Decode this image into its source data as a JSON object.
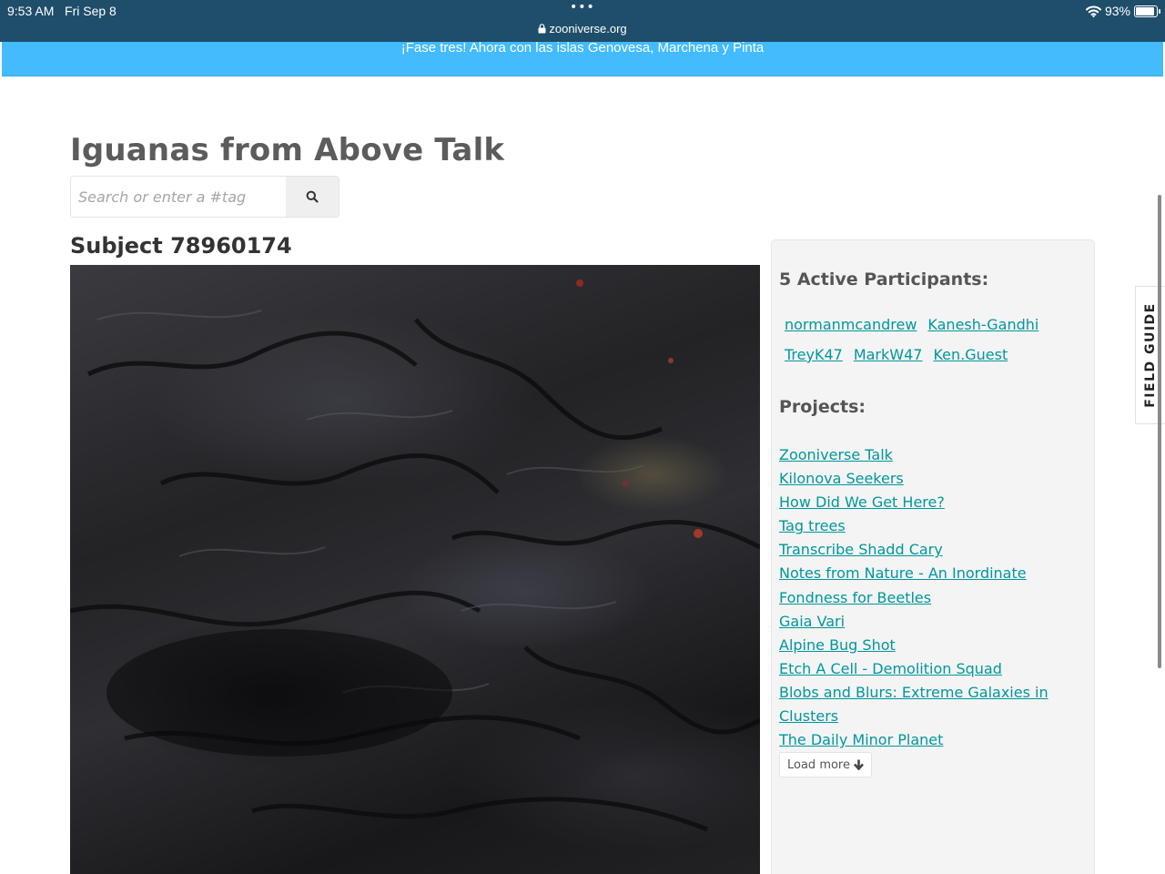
{
  "statusbar": {
    "time": "9:53 AM",
    "date": "Fri Sep 8",
    "dots": "•••",
    "url": "zooniverse.org",
    "battery": "93%",
    "battery_level": 0.93
  },
  "banner": {
    "text": "¡Fase tres! Ahora con las islas Genovesa, Marchena y Pinta"
  },
  "page": {
    "title": "Iguanas from Above Talk",
    "search_placeholder": "Search or enter a #tag",
    "subject_title": "Subject 78960174"
  },
  "sidebar": {
    "participants_title": "5 Active Participants:",
    "participants": [
      "normanmcandrew",
      "Kanesh-Gandhi",
      "TreyK47",
      "MarkW47",
      "Ken.Guest"
    ],
    "projects_title": "Projects:",
    "projects": [
      "Zooniverse Talk",
      "Kilonova Seekers",
      "How Did We Get Here?",
      "Tag trees",
      "Transcribe Shadd Cary",
      "Notes from Nature - An Inordinate ",
      "Fondness for Beetles",
      "Gaia Vari",
      "Alpine Bug Shot",
      "Etch A Cell - Demolition Squad",
      "Blobs and Blurs: Extreme Galaxies in ",
      "Clusters",
      "The Daily Minor Planet"
    ],
    "load_more": "Load more"
  },
  "field_guide": {
    "label": "FIELD GUIDE"
  }
}
